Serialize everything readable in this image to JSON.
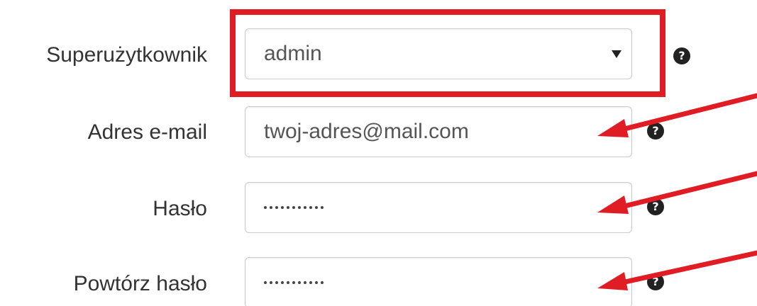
{
  "form": {
    "superuser": {
      "label": "Superużytkownik",
      "selected": "admin",
      "help": "?"
    },
    "email": {
      "label": "Adres e-mail",
      "value": "twoj-adres@mail.com",
      "help": "?"
    },
    "password": {
      "label": "Hasło",
      "masked_length": 11,
      "help": "?"
    },
    "password_repeat": {
      "label": "Powtórz hasło",
      "masked_length": 11,
      "help": "?"
    }
  },
  "annotations": {
    "highlight_color": "#e01c24",
    "arrow_color": "#e01c24"
  }
}
